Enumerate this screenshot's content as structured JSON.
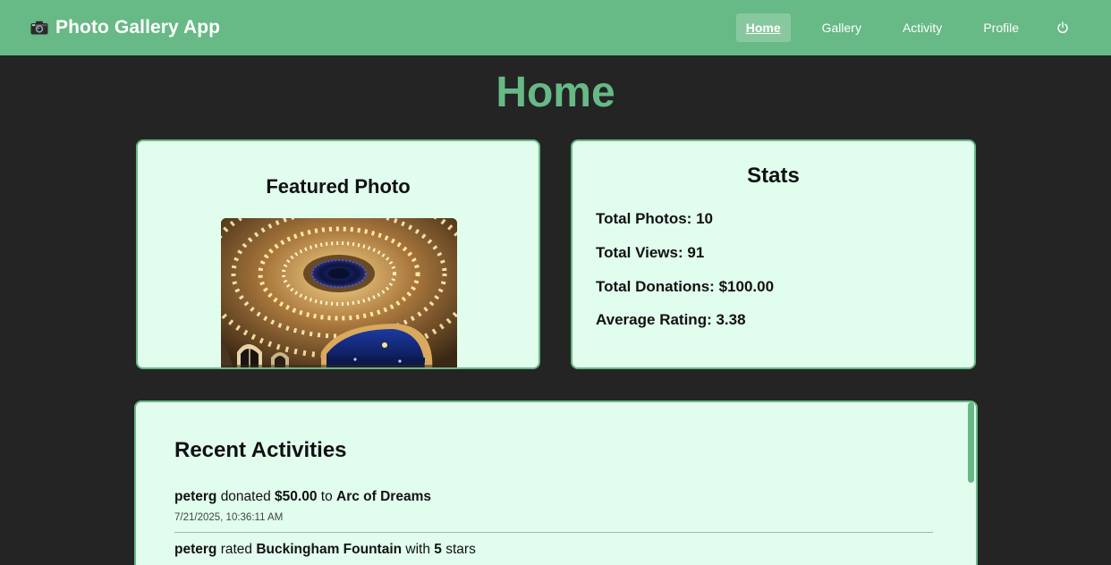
{
  "navbar": {
    "brand_icon": "camera-icon",
    "brand_title": "Photo Gallery App",
    "links": [
      {
        "label": "Home",
        "active": true
      },
      {
        "label": "Gallery",
        "active": false
      },
      {
        "label": "Activity",
        "active": false
      },
      {
        "label": "Profile",
        "active": false
      }
    ],
    "power_icon": "power-icon"
  },
  "page": {
    "title": "Home"
  },
  "featured": {
    "heading": "Featured Photo"
  },
  "stats": {
    "heading": "Stats",
    "items": [
      {
        "label": "Total Photos:",
        "value": "10"
      },
      {
        "label": "Total Views:",
        "value": "91"
      },
      {
        "label": "Total Donations:",
        "value": "$100.00"
      },
      {
        "label": "Average Rating:",
        "value": "3.38"
      }
    ]
  },
  "activities": {
    "heading": "Recent Activities",
    "items": [
      {
        "user": "peterg",
        "verb": "donated",
        "amount": "$50.00",
        "prep": "to",
        "target": "Arc of Dreams",
        "time": "7/21/2025, 10:36:11 AM"
      },
      {
        "user": "peterg",
        "verb": "rated",
        "target": "Buckingham Fountain",
        "prep": "with",
        "stars": "5",
        "suffix": "stars"
      }
    ]
  },
  "colors": {
    "accent": "#67b985",
    "card_bg": "#e1fdee",
    "page_bg": "#242424"
  }
}
